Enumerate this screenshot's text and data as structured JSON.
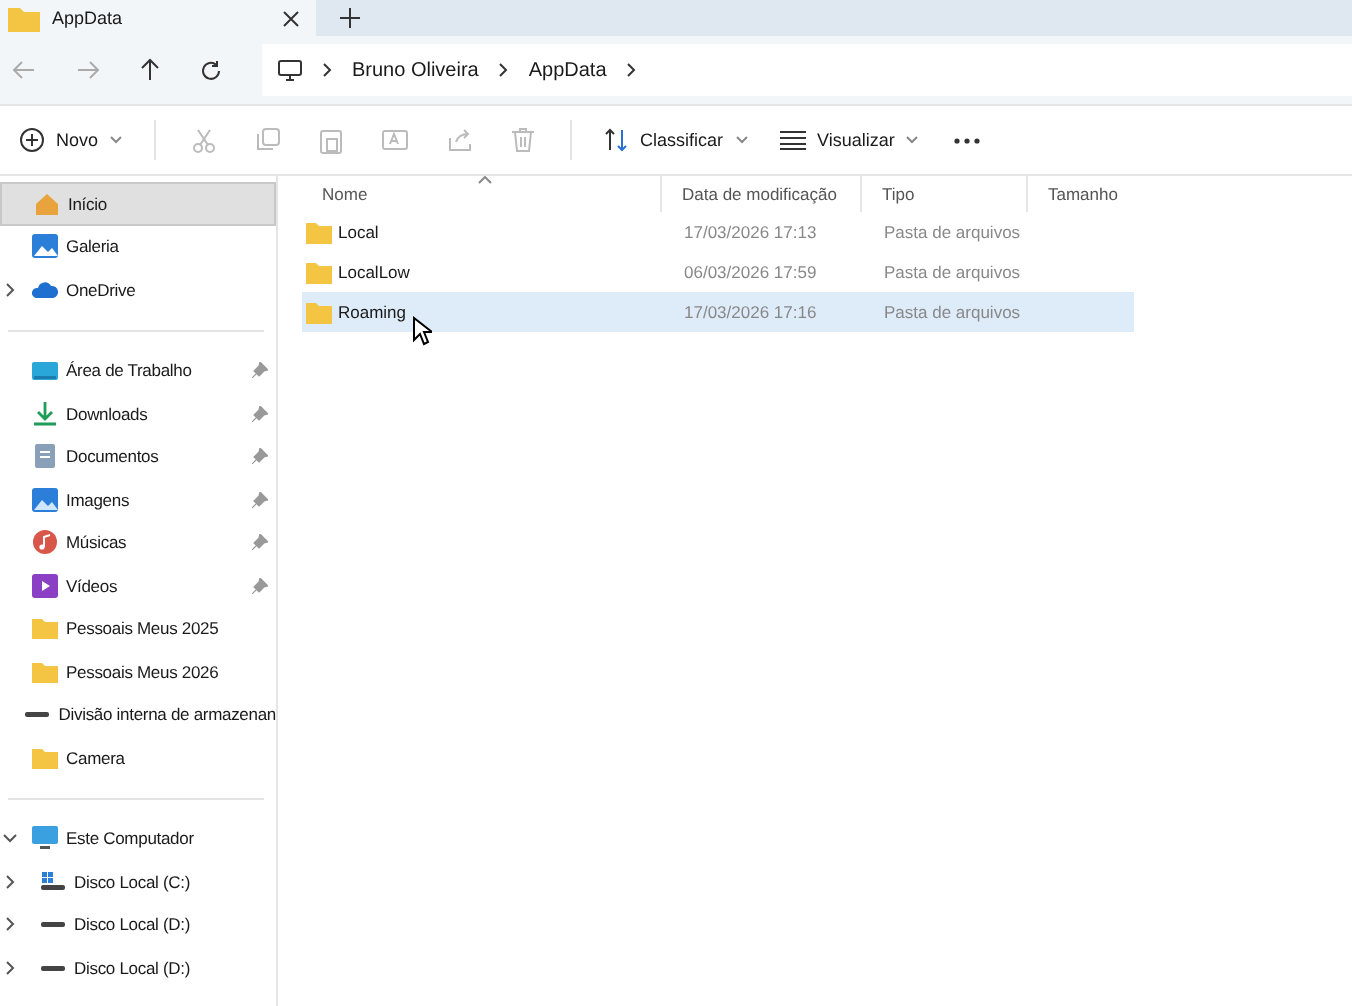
{
  "tab": {
    "title": "AppData"
  },
  "breadcrumb": [
    "Bruno Oliveira",
    "AppData"
  ],
  "toolbar": [
    {
      "kind": "new",
      "label": "Novo",
      "disabled": false
    },
    {
      "kind": "cut",
      "disabled": true
    },
    {
      "kind": "copy",
      "disabled": true
    },
    {
      "kind": "paste",
      "disabled": true
    },
    {
      "kind": "rename",
      "disabled": true
    },
    {
      "kind": "share",
      "disabled": true
    },
    {
      "kind": "delete",
      "disabled": true
    },
    {
      "kind": "sort",
      "label": "Classificar",
      "disabled": false
    },
    {
      "kind": "view",
      "label": "Visualizar",
      "disabled": false
    },
    {
      "kind": "more",
      "disabled": false
    }
  ],
  "sidebar": {
    "groups": [
      [
        {
          "kind": "home",
          "label": "Início",
          "selected": true,
          "pinned": false
        },
        {
          "kind": "gallery",
          "label": "Galeria",
          "selected": false,
          "pinned": false
        },
        {
          "kind": "cloud",
          "label": "OneDrive",
          "selected": false,
          "pinned": false,
          "expanded": false
        }
      ],
      [
        {
          "kind": "desktop",
          "label": "Área de Trabalho",
          "selected": false,
          "pinned": true
        },
        {
          "kind": "download",
          "label": "Downloads",
          "selected": false,
          "pinned": true
        },
        {
          "kind": "document",
          "label": "Documentos",
          "selected": false,
          "pinned": true
        },
        {
          "kind": "image",
          "label": "Imagens",
          "selected": false,
          "pinned": true
        },
        {
          "kind": "music",
          "label": "Músicas",
          "selected": false,
          "pinned": true
        },
        {
          "kind": "video",
          "label": "Vídeos",
          "selected": false,
          "pinned": true
        },
        {
          "kind": "folder",
          "label": "Pessoais Meus 2025",
          "selected": false,
          "pinned": false
        },
        {
          "kind": "folder",
          "label": "Pessoais Meus 2026",
          "selected": false,
          "pinned": false
        },
        {
          "kind": "drive",
          "label": "Divisão interna de armazenan",
          "selected": false,
          "pinned": false
        },
        {
          "kind": "folder",
          "label": "Camera",
          "selected": false,
          "pinned": false
        }
      ],
      [
        {
          "kind": "computer",
          "label": "Este Computador",
          "selected": false,
          "pinned": false,
          "expanded": true,
          "children": [
            {
              "kind": "system-drive",
              "label": "Disco Local (C:)",
              "selected": false,
              "pinned": false,
              "expanded": false
            },
            {
              "kind": "drive",
              "label": "Disco Local (D:)",
              "selected": false,
              "pinned": false,
              "expanded": false
            },
            {
              "kind": "drive",
              "label": "Disco Local (D:)",
              "selected": false,
              "pinned": false,
              "expanded": false
            }
          ]
        }
      ]
    ]
  },
  "table": {
    "columns": [
      "Nome",
      "Data de modificação",
      "Tipo",
      "Tamanho"
    ],
    "rows": [
      {
        "name": "Local",
        "modified": "17/03/2026 17:13",
        "type": "Pasta de arquivos",
        "selected": false
      },
      {
        "name": "LocalLow",
        "modified": "06/03/2026 17:59",
        "type": "Pasta de arquivos",
        "selected": false
      },
      {
        "name": "Roaming",
        "modified": "17/03/2026 17:16",
        "type": "Pasta de arquivos",
        "selected": true
      }
    ]
  }
}
